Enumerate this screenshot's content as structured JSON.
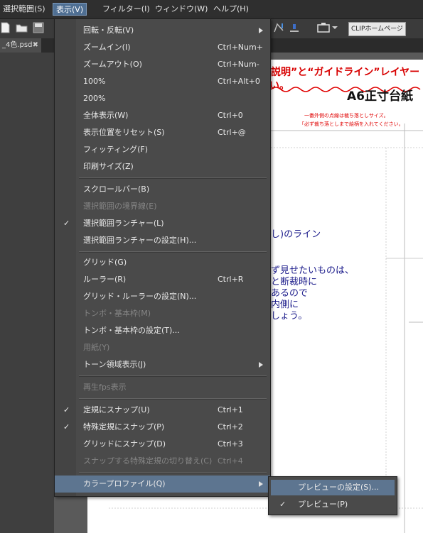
{
  "menubar": {
    "items": [
      {
        "label": "選択範囲(S)"
      },
      {
        "label": "表示(V)"
      },
      {
        "label": "フィルター(I)"
      },
      {
        "label": "ウィンドウ(W)"
      },
      {
        "label": "ヘルプ(H)"
      }
    ]
  },
  "toolbar": {
    "clip_home_label": "CLIPホームページ"
  },
  "document_tab": {
    "name": "_4色.psd",
    "close_glyph": "✖"
  },
  "canvas": {
    "top_warning": "説明”と“ガイドライン”レイヤー",
    "top_warning_line2": "い。",
    "title": "A6正寸台紙",
    "note_line1": "一番外側の点線は裁ち落としサイズ。",
    "note_line2": "「必ず裁ち落としまで絵柄を入れてください。",
    "body_line1": "し)のライン",
    "body_line2": "ず見せたいものは、",
    "body_line3": "と断裁時に",
    "body_line4": "あるので",
    "body_line5": "内側に",
    "body_line6": "しょう。"
  },
  "view_menu": {
    "items": [
      {
        "label": "回転・反転(V)",
        "shortcut": "",
        "submenu": true
      },
      {
        "label": "ズームイン(I)",
        "shortcut": "Ctrl+Num+"
      },
      {
        "label": "ズームアウト(O)",
        "shortcut": "Ctrl+Num-"
      },
      {
        "label": "100%",
        "shortcut": "Ctrl+Alt+0"
      },
      {
        "label": "200%",
        "shortcut": ""
      },
      {
        "label": "全体表示(W)",
        "shortcut": "Ctrl+0"
      },
      {
        "label": "表示位置をリセット(S)",
        "shortcut": "Ctrl+@"
      },
      {
        "label": "フィッティング(F)",
        "shortcut": ""
      },
      {
        "label": "印刷サイズ(Z)",
        "shortcut": ""
      },
      {
        "label": "スクロールバー(B)",
        "shortcut": ""
      },
      {
        "label": "選択範囲の境界線(E)",
        "shortcut": "",
        "disabled": true
      },
      {
        "label": "選択範囲ランチャー(L)",
        "shortcut": "",
        "checked": true
      },
      {
        "label": "選択範囲ランチャーの設定(H)...",
        "shortcut": ""
      },
      {
        "label": "グリッド(G)",
        "shortcut": ""
      },
      {
        "label": "ルーラー(R)",
        "shortcut": "Ctrl+R"
      },
      {
        "label": "グリッド・ルーラーの設定(N)...",
        "shortcut": ""
      },
      {
        "label": "トンボ・基本枠(M)",
        "shortcut": "",
        "disabled": true
      },
      {
        "label": "トンボ・基本枠の設定(T)...",
        "shortcut": ""
      },
      {
        "label": "用紙(Y)",
        "shortcut": "",
        "disabled": true
      },
      {
        "label": "トーン領域表示(J)",
        "shortcut": "",
        "submenu": true
      },
      {
        "label": "再生fps表示",
        "shortcut": "",
        "disabled": true
      },
      {
        "label": "定規にスナップ(U)",
        "shortcut": "Ctrl+1",
        "checked": true
      },
      {
        "label": "特殊定規にスナップ(P)",
        "shortcut": "Ctrl+2",
        "checked": true
      },
      {
        "label": "グリッドにスナップ(D)",
        "shortcut": "Ctrl+3"
      },
      {
        "label": "スナップする特殊定規の切り替え(C)",
        "shortcut": "Ctrl+4",
        "disabled": true
      },
      {
        "label": "カラープロファイル(Q)",
        "shortcut": "",
        "submenu": true,
        "highlighted": true
      }
    ]
  },
  "submenu": {
    "items": [
      {
        "label": "プレビューの設定(S)...",
        "highlighted": true
      },
      {
        "label": "プレビュー(P)",
        "checked": true
      }
    ]
  },
  "glyphs": {
    "check": "✓"
  }
}
